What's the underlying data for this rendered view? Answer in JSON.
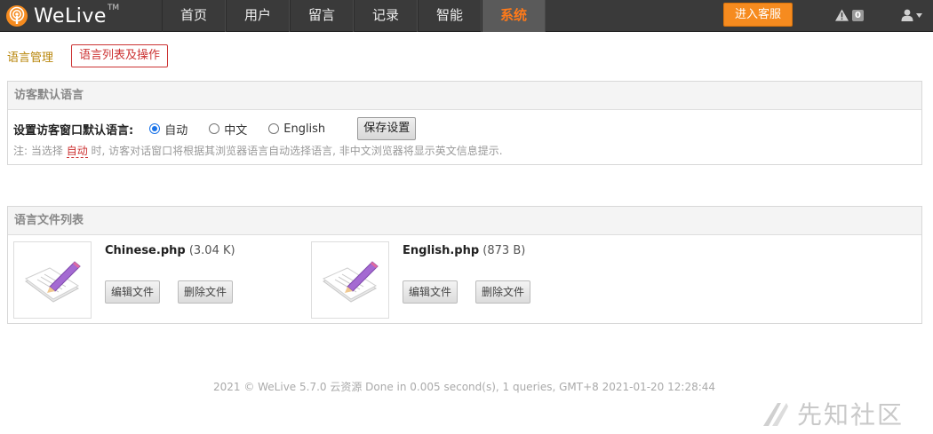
{
  "brand": {
    "name": "WeLive",
    "tm": "TM"
  },
  "nav": {
    "items": [
      {
        "label": "首页"
      },
      {
        "label": "用户"
      },
      {
        "label": "留言"
      },
      {
        "label": "记录"
      },
      {
        "label": "智能"
      },
      {
        "label": "系统",
        "active": true
      }
    ],
    "enter_label": "进入客服",
    "alert_count": "0"
  },
  "subnav": {
    "label": "语言管理",
    "tab": "语言列表及操作"
  },
  "default_lang": {
    "title": "访客默认语言",
    "label": "设置访客窗口默认语言:",
    "options": [
      "自动",
      "中文",
      "English"
    ],
    "selected": "自动",
    "save_label": "保存设置",
    "note_prefix": "注: 当选择",
    "note_highlight": "自动",
    "note_suffix": "时, 访客对话窗口将根据其浏览器语言自动选择语言, 非中文浏览器将显示英文信息提示."
  },
  "files": {
    "title": "语言文件列表",
    "items": [
      {
        "name": "Chinese.php",
        "size": "(3.04 K)",
        "edit": "编辑文件",
        "delete": "删除文件"
      },
      {
        "name": "English.php",
        "size": "(873 B)",
        "edit": "编辑文件",
        "delete": "删除文件"
      }
    ]
  },
  "footer": "2021 © WeLive 5.7.0 云资源 Done in 0.005 second(s), 1 queries, GMT+8 2021-01-20 12:28:44",
  "watermark": "先知社区",
  "colors": {
    "accent": "#f68b1f",
    "active_nav": "#ff7a1a",
    "highlight": "#cc3333",
    "label_gold": "#b8860b"
  }
}
